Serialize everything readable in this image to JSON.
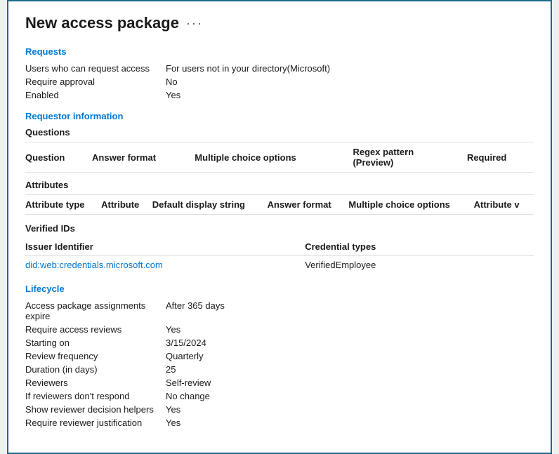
{
  "page": {
    "title": "New access package",
    "ellipsis": "···"
  },
  "requests_section": {
    "title": "Requests",
    "fields": [
      {
        "label": "Users who can request access",
        "value": "For users not in your directory(Microsoft)"
      },
      {
        "label": "Require approval",
        "value": "No"
      },
      {
        "label": "Enabled",
        "value": "Yes"
      }
    ]
  },
  "requestor_section": {
    "title": "Requestor information",
    "questions_subtitle": "Questions",
    "questions_columns": [
      "Question",
      "Answer format",
      "Multiple choice options",
      "Regex pattern (Preview)",
      "Required"
    ],
    "questions_rows": [],
    "attributes_subtitle": "Attributes",
    "attributes_columns": [
      "Attribute type",
      "Attribute",
      "Default display string",
      "Answer format",
      "Multiple choice options",
      "Attribute v"
    ],
    "attributes_rows": []
  },
  "verified_ids_section": {
    "title": "Verified IDs",
    "columns": {
      "issuer": "Issuer Identifier",
      "credential": "Credential types"
    },
    "rows": [
      {
        "issuer": "did:web:credentials.microsoft.com",
        "credential": "VerifiedEmployee"
      }
    ]
  },
  "lifecycle_section": {
    "title": "Lifecycle",
    "fields": [
      {
        "label": "Access package assignments expire",
        "value": "After 365 days"
      },
      {
        "label": "Require access reviews",
        "value": "Yes"
      },
      {
        "label": "Starting on",
        "value": "3/15/2024"
      },
      {
        "label": "Review frequency",
        "value": "Quarterly"
      },
      {
        "label": "Duration (in days)",
        "value": "25"
      },
      {
        "label": "Reviewers",
        "value": "Self-review"
      },
      {
        "label": "If reviewers don't respond",
        "value": "No change"
      },
      {
        "label": "Show reviewer decision helpers",
        "value": "Yes"
      },
      {
        "label": "Require reviewer justification",
        "value": "Yes"
      }
    ]
  }
}
